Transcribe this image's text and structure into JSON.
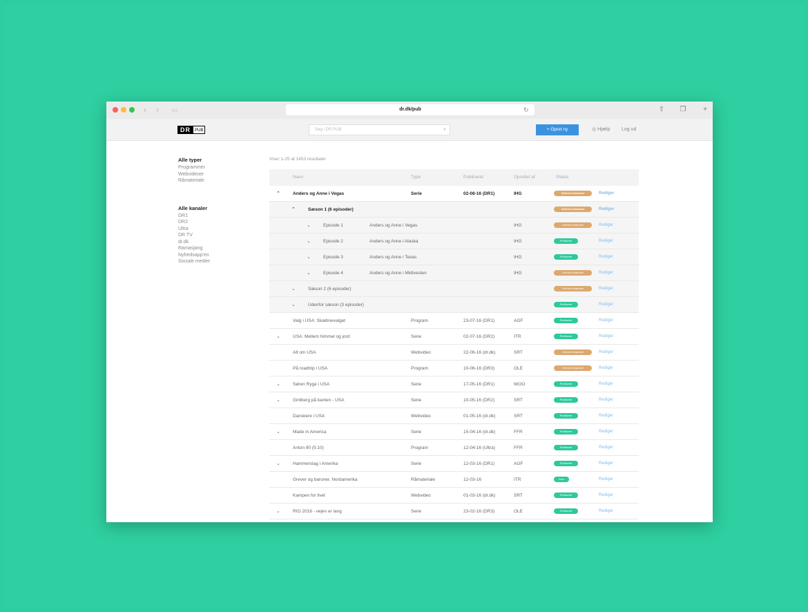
{
  "browser": {
    "url": "dr.dk/pub",
    "reload_icon": "reload-icon",
    "colors": {
      "close": "#fc605b",
      "minimize": "#fdbc40",
      "maximize": "#34c84a"
    }
  },
  "app": {
    "logo_dr": "DR",
    "logo_pub": "PUB",
    "search_placeholder": "Søg i DR PUB",
    "create_button": "+ Opret ny",
    "help": "Hjælp",
    "logout": "Log ud",
    "accent": "#3b93e0"
  },
  "sidebar": {
    "types_heading": "Alle typer",
    "types": [
      "Programmer",
      "Webvideoer",
      "Råmateriale"
    ],
    "channels_heading": "Alle kanaler",
    "channels": [
      "DR1",
      "DR2",
      "Ultra",
      "DR TV",
      "dr.dk",
      "Ramasjang",
      "Nyhedsapp'en",
      "Sociale medier"
    ]
  },
  "results_text": "Viser 1-25 af 1453 resultater",
  "table": {
    "headers": {
      "name": "Navn",
      "type": "Type",
      "published": "Publiceret",
      "created_by": "Oprettet af",
      "status": "Status"
    },
    "edit_label": "Rediger",
    "status_labels": {
      "orange": "Delvist behandlet",
      "green": "Publiceret",
      "small": "Gem"
    },
    "rows": [
      {
        "level": 0,
        "chev": "^",
        "name": "Anders og Anne i Vegas",
        "type": "Serie",
        "published": "02-08-16 (DR1)",
        "by": "IHG",
        "status": "orange",
        "bold": true
      },
      {
        "level": 1,
        "chev": "^",
        "name": "Sæson 1 (6 episoder)",
        "type": "",
        "published": "",
        "by": "",
        "status": "orange",
        "bold": true,
        "grey": true
      },
      {
        "level": 2,
        "chev": "v",
        "name": "Episode 1",
        "title": "Anders og Anne i Vegas",
        "by": "IHG",
        "status": "orange",
        "grey": true
      },
      {
        "level": 2,
        "chev": "v",
        "name": "Episode 2",
        "title": "Anders og Anne i Alaska",
        "by": "IHG",
        "status": "green",
        "grey": true
      },
      {
        "level": 2,
        "chev": "v",
        "name": "Episode 3",
        "title": "Anders og Anne i Texas",
        "by": "IHG",
        "status": "green",
        "grey": true
      },
      {
        "level": 2,
        "chev": "v",
        "name": "Episode 4",
        "title": "Anders og Anne i Midtvesten",
        "by": "IHG",
        "status": "orange",
        "grey": true
      },
      {
        "level": 1,
        "chev": "v",
        "name": "Sæson 2 (6 episoder)",
        "status": "orange",
        "grey": true
      },
      {
        "level": 1,
        "chev": "v",
        "name": "Udenfor sæson (3 episoder)",
        "status": "green",
        "grey": true
      },
      {
        "level": 0,
        "chev": "",
        "name": "Valg i USA: Skæbnevalget",
        "type": "Program",
        "published": "23-07-16 (DR1)",
        "by": "AGF",
        "status": "green"
      },
      {
        "level": 0,
        "chev": "v",
        "name": "USA: Mellem himmel og jord",
        "type": "Serie",
        "published": "02-07-16 (DR2)",
        "by": "ITR",
        "status": "green"
      },
      {
        "level": 0,
        "chev": "",
        "name": "Alt om USA",
        "type": "Webvideo",
        "published": "22-06-16 (dr.dk)",
        "by": "SRT",
        "status": "orange"
      },
      {
        "level": 0,
        "chev": "",
        "name": "På roadtrip i USA",
        "type": "Program",
        "published": "10-06-16 (DR3)",
        "by": "OLE",
        "status": "orange"
      },
      {
        "level": 0,
        "chev": "v",
        "name": "Søren Ryge i USA",
        "type": "Serie",
        "published": "17-05-16 (DR1)",
        "by": "WOO",
        "status": "green"
      },
      {
        "level": 0,
        "chev": "v",
        "name": "Gintberg på kanten - USA",
        "type": "Serie",
        "published": "10-05-16 (DR2)",
        "by": "SRT",
        "status": "green"
      },
      {
        "level": 0,
        "chev": "",
        "name": "Danskere i USA",
        "type": "Webvideo",
        "published": "01-05-16 (dr.dk)",
        "by": "SRT",
        "status": "green"
      },
      {
        "level": 0,
        "chev": "v",
        "name": "Made in America",
        "type": "Serie",
        "published": "15-04-16 (dr.dk)",
        "by": "FFR",
        "status": "green"
      },
      {
        "level": 0,
        "chev": "",
        "name": "Anton 90 (5:10)",
        "type": "Program",
        "published": "12-04-16 (Ultra)",
        "by": "FFR",
        "status": "green"
      },
      {
        "level": 0,
        "chev": "v",
        "name": "Hammerslag i Amerika",
        "type": "Serie",
        "published": "12-03-16 (DR1)",
        "by": "AGF",
        "status": "green"
      },
      {
        "level": 0,
        "chev": "",
        "name": "Grever og baroner, Nordamerika",
        "type": "Råmateriale",
        "published": "12-03-16",
        "by": "ITR",
        "status": "small"
      },
      {
        "level": 0,
        "chev": "",
        "name": "Kampen for livet",
        "type": "Webvideo",
        "published": "01-03-16 (dr.dk)",
        "by": "SRT",
        "status": "green"
      },
      {
        "level": 0,
        "chev": "v",
        "name": "RIO 2016 - vejen er lang",
        "type": "Serie",
        "published": "23-02-16 (DR3)",
        "by": "OLE",
        "status": "green"
      }
    ]
  }
}
